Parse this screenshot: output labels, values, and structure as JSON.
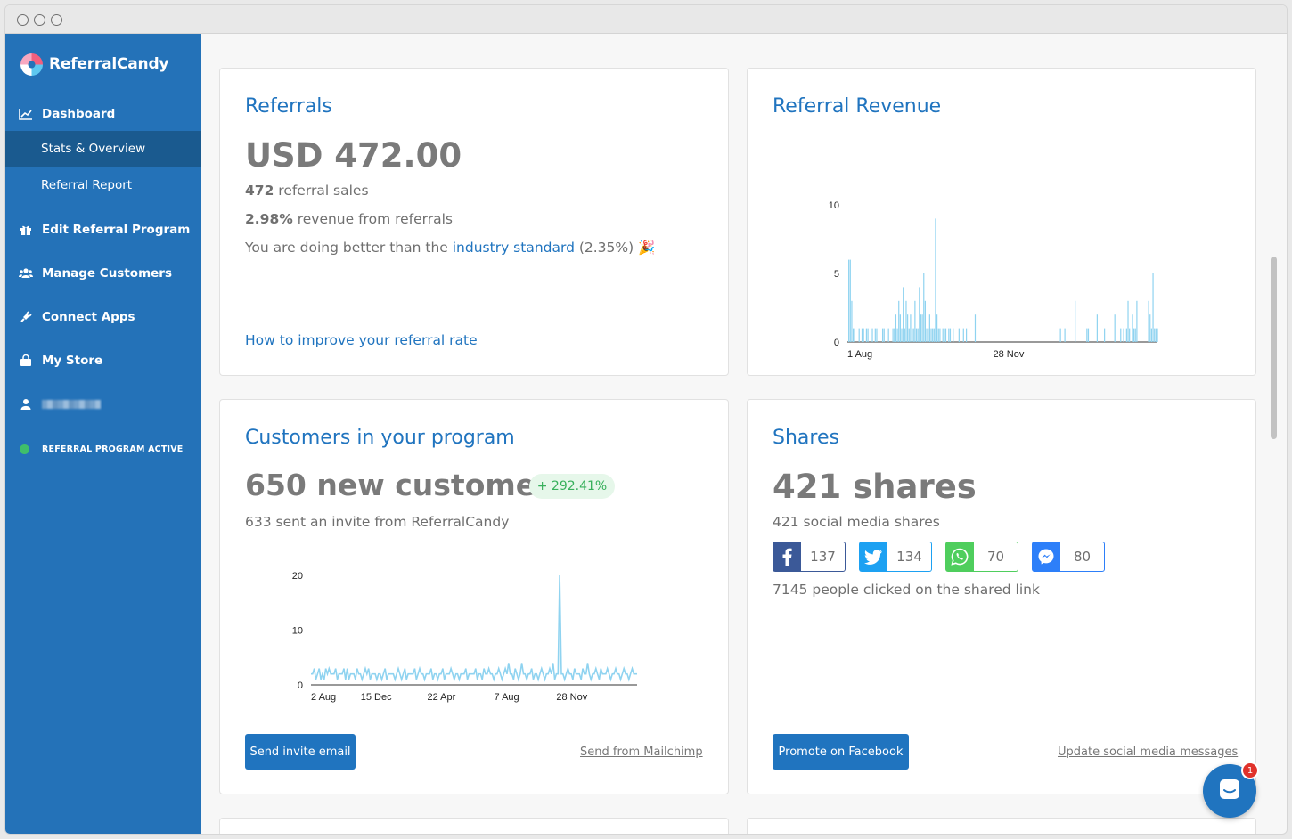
{
  "app": {
    "name": "ReferralCandy"
  },
  "sidebar": {
    "dashboard_label": "Dashboard",
    "sub_items": [
      {
        "label": "Stats & Overview",
        "active": true
      },
      {
        "label": "Referral Report",
        "active": false
      }
    ],
    "items": [
      {
        "label": "Edit Referral Program",
        "icon": "gift-icon"
      },
      {
        "label": "Manage Customers",
        "icon": "users-icon"
      },
      {
        "label": "Connect Apps",
        "icon": "plug-icon"
      },
      {
        "label": "My Store",
        "icon": "shopping-bag-icon"
      }
    ],
    "user_icon": "user-icon",
    "status_label": "REFERRAL PROGRAM ACTIVE",
    "status_color": "#3fbf6b"
  },
  "referrals": {
    "title": "Referrals",
    "amount": "USD 472.00",
    "sales_count": "472",
    "sales_suffix": " referral sales",
    "revenue_pct": "2.98%",
    "revenue_suffix": " revenue from referrals",
    "industry_prefix": "You are doing better than the ",
    "industry_link": "industry standard",
    "industry_suffix": " (2.35%) 🎉",
    "improve_link": "How to improve your referral rate"
  },
  "revenue": {
    "title": "Referral Revenue"
  },
  "customers": {
    "title": "Customers in your program",
    "headline": "650 new customers",
    "change_badge": "+ 292.41%",
    "invites_line": "633 sent an invite from ReferralCandy",
    "send_button": "Send invite email",
    "mailchimp_link": "Send from Mailchimp"
  },
  "shares": {
    "title": "Shares",
    "headline": "421 shares",
    "social_line": "421 social media shares",
    "networks": [
      {
        "name": "facebook",
        "icon": "facebook-icon",
        "count": "137",
        "color": "#3b5998"
      },
      {
        "name": "twitter",
        "icon": "twitter-icon",
        "count": "134",
        "color": "#1da1f2"
      },
      {
        "name": "whatsapp",
        "icon": "whatsapp-icon",
        "count": "70",
        "color": "#4fce5d"
      },
      {
        "name": "messenger",
        "icon": "messenger-icon",
        "count": "80",
        "color": "#2d7ff9"
      }
    ],
    "clicks_line": "7145 people clicked on the shared link",
    "promote_button": "Promote on Facebook",
    "update_link": "Update social media messages"
  },
  "chat": {
    "icon": "chat-icon",
    "badge": "1"
  },
  "chart_data": [
    {
      "type": "bar",
      "x_tick_labels": [
        "1 Aug",
        "28 Nov"
      ],
      "y_ticks": [
        0,
        5,
        10
      ],
      "ylim": [
        0,
        10
      ],
      "color": "#8fd3f0",
      "values": [
        0,
        6,
        6,
        3,
        1,
        1,
        0,
        0,
        1,
        0,
        1,
        1,
        0,
        1,
        1,
        0,
        0,
        1,
        0,
        1,
        1,
        0,
        0,
        0,
        1,
        1,
        0,
        0,
        1,
        0,
        0,
        1,
        1,
        2,
        1,
        3,
        2,
        1,
        4,
        1,
        3,
        2,
        1,
        2,
        1,
        1,
        3,
        1,
        1,
        4,
        2,
        2,
        5,
        3,
        1,
        1,
        2,
        1,
        1,
        1,
        9,
        2,
        1,
        1,
        0,
        1,
        1,
        1,
        0,
        1,
        1,
        0,
        1,
        0,
        0,
        0,
        1,
        0,
        0,
        1,
        0,
        1,
        0,
        0,
        0,
        0,
        0,
        2,
        0,
        0,
        0,
        0,
        0,
        0,
        0,
        0,
        0,
        0,
        0,
        0,
        0,
        0,
        0,
        0,
        0,
        0,
        0,
        0,
        0,
        0,
        0,
        0,
        0,
        0,
        0,
        0,
        0,
        0,
        0,
        0,
        0,
        0,
        0,
        0,
        0,
        0,
        0,
        0,
        0,
        0,
        0,
        0,
        0,
        0,
        0,
        0,
        0,
        0,
        0,
        0,
        0,
        0,
        0,
        0,
        0,
        1,
        0,
        0,
        1,
        0,
        0,
        0,
        0,
        0,
        0,
        3,
        0,
        0,
        0,
        0,
        0,
        0,
        0,
        1,
        1,
        0,
        0,
        0,
        0,
        0,
        2,
        0,
        0,
        0,
        0,
        1,
        0,
        0,
        0,
        0,
        0,
        0,
        2,
        0,
        0,
        0,
        1,
        0,
        1,
        0,
        1,
        3,
        1,
        0,
        2,
        1,
        1,
        3,
        0,
        0,
        0,
        0,
        0,
        0,
        0,
        3,
        2,
        1,
        5,
        1,
        1,
        1
      ]
    },
    {
      "type": "line",
      "x_tick_labels": [
        "2 Aug",
        "15 Dec",
        "22 Apr",
        "7 Aug",
        "28 Nov"
      ],
      "y_ticks": [
        0,
        10,
        20
      ],
      "ylim": [
        0,
        20
      ],
      "color": "#8fd3f0",
      "values": [
        2,
        2,
        3,
        1,
        2,
        3,
        1,
        2,
        1,
        3,
        2,
        3,
        2,
        2,
        2,
        3,
        1,
        2,
        2,
        2,
        3,
        1,
        3,
        1,
        2,
        2,
        2,
        1,
        3,
        2,
        2,
        1,
        2,
        3,
        2,
        3,
        1,
        2,
        2,
        2,
        1,
        2,
        2,
        1,
        2,
        3,
        1,
        2,
        2,
        2,
        2,
        1,
        2,
        3,
        2,
        1,
        2,
        3,
        1,
        2,
        2,
        2,
        2,
        3,
        1,
        2,
        3,
        2,
        2,
        1,
        2,
        2,
        2,
        3,
        1,
        2,
        2,
        1,
        2,
        2,
        3,
        1,
        2,
        2,
        2,
        3,
        2,
        1,
        2,
        2,
        1,
        2,
        2,
        2,
        3,
        1,
        2,
        2,
        2,
        2,
        3,
        1,
        2,
        2,
        1,
        3,
        2,
        2,
        3,
        2,
        2,
        1,
        2,
        2,
        3,
        2,
        1,
        2,
        3,
        2,
        4,
        2,
        2,
        1,
        3,
        2,
        1,
        2,
        4,
        2,
        2,
        1,
        2,
        2,
        3,
        1,
        2,
        2,
        1,
        2,
        3,
        2,
        1,
        2,
        2,
        3,
        2,
        4,
        1,
        2,
        2,
        20,
        2,
        2,
        1,
        2,
        3,
        2,
        2,
        1,
        3,
        2,
        2,
        2,
        1,
        3,
        2,
        2,
        4,
        2,
        1,
        2,
        2,
        3,
        2,
        1,
        3,
        2,
        2,
        2,
        3,
        2,
        1,
        2,
        2,
        3,
        2,
        2,
        1,
        2,
        3,
        2,
        2,
        1,
        2,
        3,
        2,
        2,
        2
      ]
    }
  ]
}
